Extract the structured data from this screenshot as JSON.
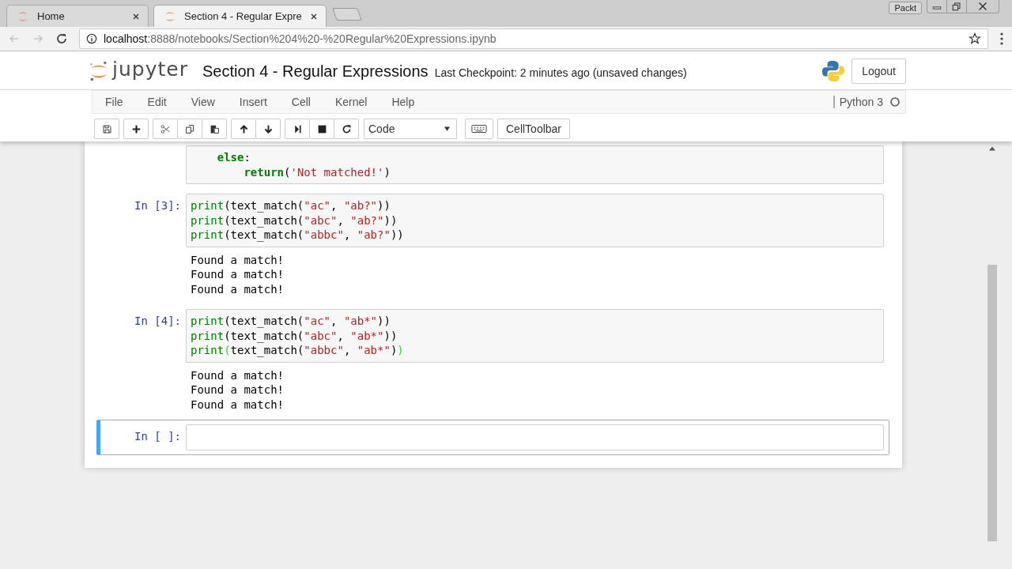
{
  "browser": {
    "tabs": [
      {
        "title": "Home",
        "selected": false
      },
      {
        "title": "Section 4 - Regular Expre",
        "selected": true
      }
    ],
    "profile": "Packt",
    "address": {
      "host": "localhost",
      "path": ":8888/notebooks/Section%204%20-%20Regular%20Expressions.ipynb"
    }
  },
  "header": {
    "logo": "jupyter",
    "notebook_title": "Section 4 - Regular Expressions",
    "checkpoint": "Last Checkpoint: 2 minutes ago (unsaved changes)",
    "logout": "Logout"
  },
  "menu": {
    "items": [
      "File",
      "Edit",
      "View",
      "Insert",
      "Cell",
      "Kernel",
      "Help"
    ],
    "kernel": "Python 3"
  },
  "toolbar": {
    "cell_type": "Code",
    "cell_toolbar": "CellToolbar"
  },
  "cells": [
    {
      "selected": false,
      "lines": [
        [
          {
            "kind": "keyword",
            "text": "    else"
          },
          {
            "kind": "plain",
            "text": ":"
          }
        ],
        [
          {
            "kind": "keyword",
            "text": "        return"
          },
          {
            "kind": "plain",
            "text": "("
          },
          {
            "kind": "string",
            "text": "'Not matched!'"
          },
          {
            "kind": "plain",
            "text": ")"
          }
        ]
      ]
    },
    {
      "prompt": "In [3]:",
      "selected": false,
      "lines": [
        [
          {
            "kind": "builtin",
            "text": "print"
          },
          {
            "kind": "plain",
            "text": "(text_match("
          },
          {
            "kind": "string",
            "text": "\"ac\""
          },
          {
            "kind": "plain",
            "text": ", "
          },
          {
            "kind": "string",
            "text": "\"ab?\""
          },
          {
            "kind": "plain",
            "text": "))"
          }
        ],
        [
          {
            "kind": "builtin",
            "text": "print"
          },
          {
            "kind": "plain",
            "text": "(text_match("
          },
          {
            "kind": "string",
            "text": "\"abc\""
          },
          {
            "kind": "plain",
            "text": ", "
          },
          {
            "kind": "string",
            "text": "\"ab?\""
          },
          {
            "kind": "plain",
            "text": "))"
          }
        ],
        [
          {
            "kind": "builtin",
            "text": "print"
          },
          {
            "kind": "plain",
            "text": "(text_match("
          },
          {
            "kind": "string",
            "text": "\"abbc\""
          },
          {
            "kind": "plain",
            "text": ", "
          },
          {
            "kind": "string",
            "text": "\"ab?\""
          },
          {
            "kind": "plain",
            "text": "))"
          }
        ]
      ],
      "outputs": [
        "Found a match!",
        "Found a match!",
        "Found a match!"
      ]
    },
    {
      "prompt": "In [4]:",
      "selected": false,
      "lines": [
        [
          {
            "kind": "builtin",
            "text": "print"
          },
          {
            "kind": "plain",
            "text": "(text_match("
          },
          {
            "kind": "string",
            "text": "\"ac\""
          },
          {
            "kind": "plain",
            "text": ", "
          },
          {
            "kind": "string",
            "text": "\"ab*\""
          },
          {
            "kind": "plain",
            "text": "))"
          }
        ],
        [
          {
            "kind": "builtin",
            "text": "print"
          },
          {
            "kind": "plain",
            "text": "(text_match("
          },
          {
            "kind": "string",
            "text": "\"abc\""
          },
          {
            "kind": "plain",
            "text": ", "
          },
          {
            "kind": "string",
            "text": "\"ab*\""
          },
          {
            "kind": "plain",
            "text": "))"
          }
        ],
        [
          {
            "kind": "builtin",
            "text": "print"
          },
          {
            "kind": "match",
            "text": "("
          },
          {
            "kind": "plain",
            "text": "text_match("
          },
          {
            "kind": "string",
            "text": "\"abbc\""
          },
          {
            "kind": "plain",
            "text": ", "
          },
          {
            "kind": "string",
            "text": "\"ab*\""
          },
          {
            "kind": "plain",
            "text": ")"
          },
          {
            "kind": "match",
            "text": ")"
          }
        ]
      ],
      "outputs": [
        "Found a match!",
        "Found a match!",
        "Found a match!"
      ]
    },
    {
      "prompt": "In [ ]:",
      "selected": true
    }
  ]
}
